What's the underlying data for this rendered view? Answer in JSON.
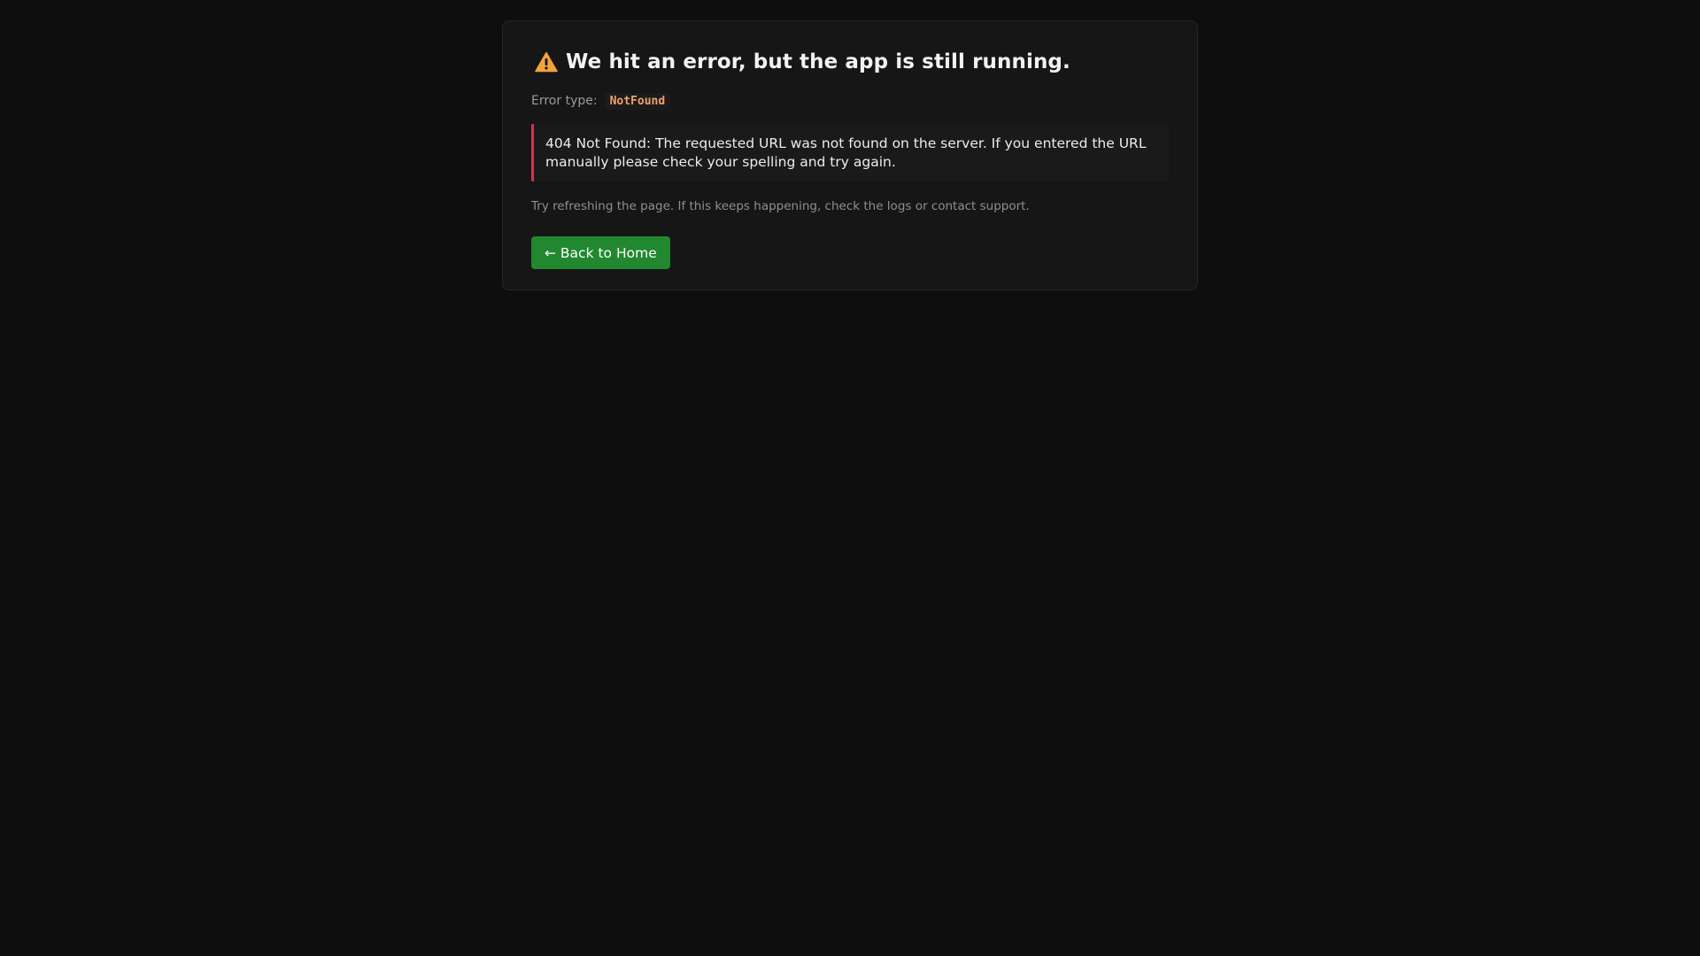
{
  "error_card": {
    "title": "We hit an error, but the app is still running.",
    "warning_icon": "warning-triangle-icon",
    "error_type_label": "Error type:",
    "error_type_value": "NotFound",
    "message": "404 Not Found: The requested URL was not found on the server. If you entered the URL manually please check your spelling and try again.",
    "hint": "Try refreshing the page. If this keeps happening, check the logs or contact support.",
    "back_button_label": "← Back to Home"
  },
  "colors": {
    "page_background": "#0e0e0e",
    "card_background": "#161616",
    "warning_icon": "#f2a33a",
    "error_type_code": "#f0a070",
    "message_accent": "#d0354a",
    "button_background": "#22882f"
  }
}
